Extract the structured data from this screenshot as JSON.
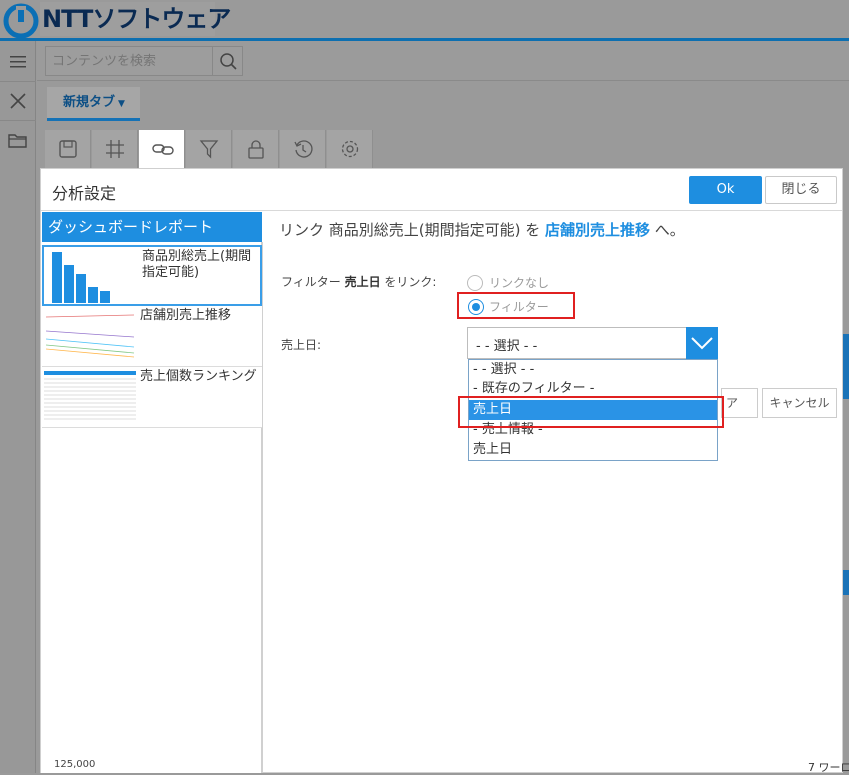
{
  "header": {
    "brand": "NTTソフトウェア"
  },
  "search": {
    "placeholder": "コンテンツを検索"
  },
  "tabs": [
    {
      "label": "新規タブ"
    }
  ],
  "panel": {
    "title": "分析設定",
    "ok_label": "Ok",
    "close_label": "閉じる",
    "left_heading": "ダッシュボードレポート",
    "reports": [
      {
        "label": "商品別総売上(期間指定可能)"
      },
      {
        "label": "店舗別売上推移"
      },
      {
        "label": "売上個数ランキング"
      }
    ],
    "link_heading_prefix": "リンク 商品別総売上(期間指定可能) を ",
    "link_target": "店舗別売上推移",
    "link_heading_suffix": " へ。",
    "filter_label_prefix": "フィルター ",
    "filter_field": "売上日",
    "filter_label_suffix": " をリンク:",
    "radio_none_label": "リンクなし",
    "radio_filter_label": "フィルター",
    "date_field_label": "売上日:",
    "select_value": "- - 選択 - -",
    "dropdown_options": [
      "- - 選択 - -",
      "- 既存のフィルター -",
      "売上日",
      "- 売上情報 -",
      "売上日"
    ],
    "behind_button_label": "ア",
    "cancel_label": "キャンセル"
  },
  "background": {
    "axis_label": "125,000",
    "right_text": "7 ワーロ"
  },
  "colors": {
    "accent": "#1e8ee0",
    "highlight": "#e02020"
  }
}
